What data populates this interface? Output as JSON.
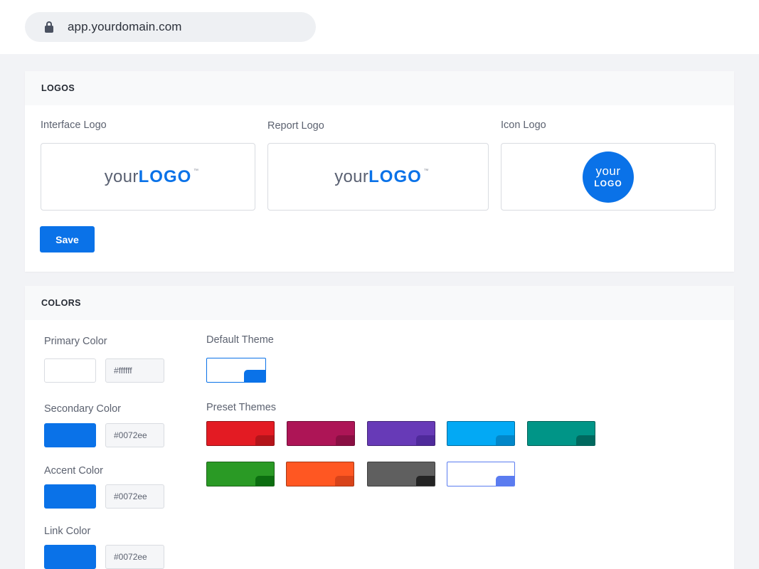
{
  "browser": {
    "url": "app.yourdomain.com",
    "lock_icon": "lock-icon"
  },
  "logos": {
    "section_title": "LOGOS",
    "interface_label": "Interface Logo",
    "report_label": "Report Logo",
    "icon_label": "Icon Logo",
    "wordmark_prefix": "your",
    "wordmark_main": "LOGO",
    "wordmark_tm": "™",
    "icon_line1": "your",
    "icon_line2": "LOGO",
    "save_label": "Save"
  },
  "colors": {
    "section_title": "COLORS",
    "fields": [
      {
        "label": "Primary Color",
        "value": "#ffffff",
        "swatch": "#ffffff"
      },
      {
        "label": "Secondary Color",
        "value": "#0072ee",
        "swatch": "#0a72e8"
      },
      {
        "label": "Accent Color",
        "value": "#0072ee",
        "swatch": "#0a72e8"
      },
      {
        "label": "Link Color",
        "value": "#0072ee",
        "swatch": "#0a72e8"
      }
    ],
    "default_theme_label": "Default Theme",
    "preset_themes_label": "Preset Themes",
    "presets": [
      {
        "name": "red",
        "main": "#e31b23",
        "tab": "#b4141a"
      },
      {
        "name": "magenta",
        "main": "#ad1556",
        "tab": "#8a0f43"
      },
      {
        "name": "purple",
        "main": "#673ab7",
        "tab": "#4f2a9b"
      },
      {
        "name": "sky",
        "main": "#03a9f4",
        "tab": "#0287c9"
      },
      {
        "name": "teal",
        "main": "#009587",
        "tab": "#00695f"
      },
      {
        "name": "green",
        "main": "#2a9a25",
        "tab": "#0c6e10"
      },
      {
        "name": "orange",
        "main": "#ff5722",
        "tab": "#d8431a"
      },
      {
        "name": "gray",
        "main": "#5f5f5f",
        "tab": "#242424"
      },
      {
        "name": "light",
        "main": "#ffffff",
        "tab": "#5b7cf0",
        "border": "#5b7cf0"
      }
    ]
  }
}
